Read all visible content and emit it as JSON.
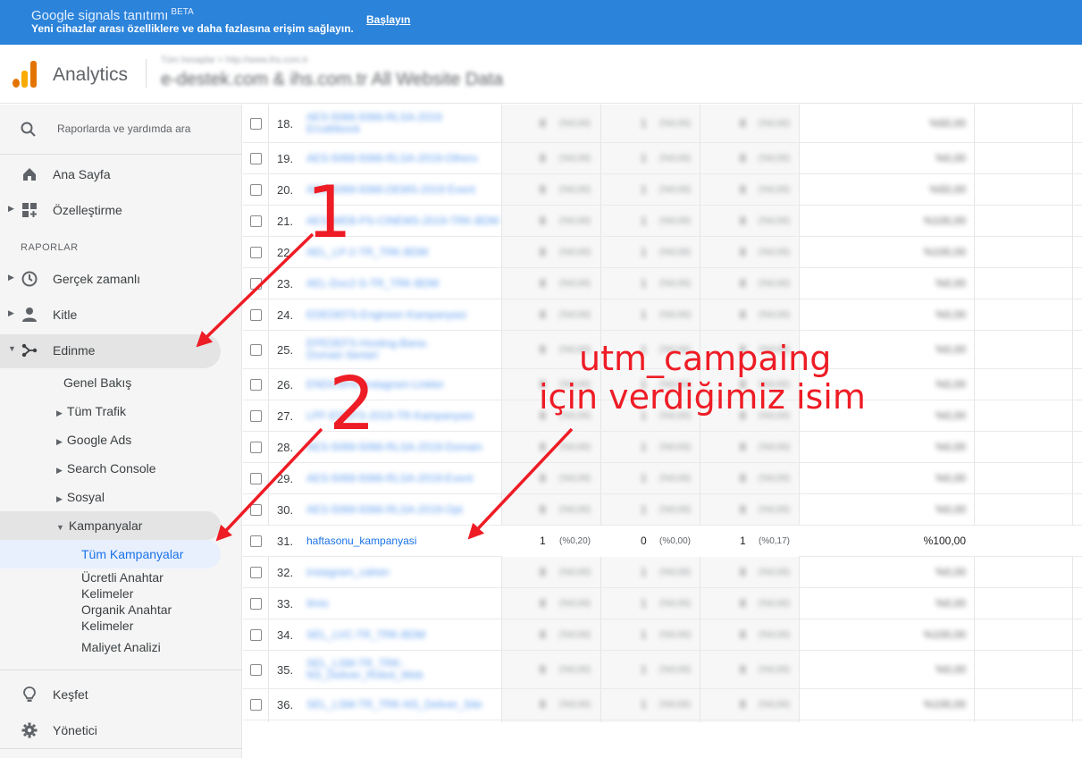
{
  "banner": {
    "title": "Google signals tanıtımı",
    "badge": "BETA",
    "subtitle": "Yeni cihazlar arası özelliklere ve daha fazlasına erişim sağlayın.",
    "cta": "Başlayın"
  },
  "header": {
    "app_name": "Analytics",
    "breadcrumb": "Tüm hesaplar > http://www.ihs.com.tr",
    "property": "e-destek.com & ihs.com.tr All Website Data"
  },
  "sidebar": {
    "search_placeholder": "Raporlarda ve yardımda ara",
    "home": "Ana Sayfa",
    "customize": "Özelleştirme",
    "section": "RAPORLAR",
    "realtime": "Gerçek zamanlı",
    "audience": "Kitle",
    "acquisition": "Edinme",
    "overview": "Genel Bakış",
    "all_traffic": "Tüm Trafik",
    "google_ads": "Google Ads",
    "search_console": "Search Console",
    "social": "Sosyal",
    "campaigns": "Kampanyalar",
    "all_campaigns": "Tüm Kampanyalar",
    "paid_keywords_1": "Ücretli Anahtar",
    "paid_keywords_2": "Kelimeler",
    "organic_keywords_1": "Organik Anahtar",
    "organic_keywords_2": "Kelimeler",
    "cost_analysis": "Maliyet Analizi",
    "discover": "Keşfet",
    "admin": "Yönetici"
  },
  "table": {
    "rows": [
      {
        "n": "18.",
        "name": "AES-5066-5066-RLSA-2019 Ercafébock",
        "v1": "8",
        "p1": "(%0,00)",
        "v2": "1",
        "p2": "(%0,00)",
        "v3": "8",
        "p3": "(%0,00)",
        "r": "%50,00"
      },
      {
        "n": "19.",
        "name": "AES-5069-5066-RLSA-2019-Others",
        "v1": "8",
        "p1": "(%0,00)",
        "v2": "1",
        "p2": "(%0,00)",
        "v3": "8",
        "p3": "(%0,00)",
        "r": "%0,00"
      },
      {
        "n": "20.",
        "name": "AES-5069-5066-DEMS-2019 Event",
        "v1": "8",
        "p1": "(%0,00)",
        "v2": "1",
        "p2": "(%0,00)",
        "v3": "8",
        "p3": "(%0,00)",
        "r": "%50,00"
      },
      {
        "n": "21.",
        "name": "AES-WEB-PS-CINEMS-2019-TRK-BDM",
        "v1": "8",
        "p1": "(%0,00)",
        "v2": "1",
        "p2": "(%0,00)",
        "v3": "8",
        "p3": "(%0,00)",
        "r": "%100,00"
      },
      {
        "n": "22.",
        "name": "AEL_LP-2-TR_TRK-BDM",
        "v1": "8",
        "p1": "(%0,00)",
        "v2": "1",
        "p2": "(%0,00)",
        "v3": "8",
        "p3": "(%0,00)",
        "r": "%100,00"
      },
      {
        "n": "23.",
        "name": "AEL-Doc2-S-TR_TRK-BDM",
        "v1": "8",
        "p1": "(%0,00)",
        "v2": "1",
        "p2": "(%0,00)",
        "v3": "8",
        "p3": "(%0,00)",
        "r": "%0,00"
      },
      {
        "n": "24.",
        "name": "EDEDEFS-Engineer-Kampanyasi",
        "v1": "8",
        "p1": "(%0,00)",
        "v2": "1",
        "p2": "(%0,00)",
        "v3": "8",
        "p3": "(%0,00)",
        "r": "%0,00"
      },
      {
        "n": "25.",
        "name": "EPEDEFS-Hosting-Bana-Domain Ilanlari",
        "v1": "8",
        "p1": "(%0,00)",
        "v2": "1",
        "p2": "(%0,00)",
        "v3": "8",
        "p3": "(%0,00)",
        "r": "%0,00"
      },
      {
        "n": "26.",
        "name": "ENDOSFA-Instagram-Linkler",
        "v1": "8",
        "p1": "(%0,00)",
        "v2": "1",
        "p2": "(%0,00)",
        "v3": "8",
        "p3": "(%0,00)",
        "r": "%0,00"
      },
      {
        "n": "27.",
        "name": "LPF-EDEFS-2019-TR-Kampanyasi",
        "v1": "8",
        "p1": "(%0,00)",
        "v2": "1",
        "p2": "(%0,00)",
        "v3": "8",
        "p3": "(%0,00)",
        "r": "%0,00"
      },
      {
        "n": "28.",
        "name": "AES-5069-5066-RLSA-2019-Domain",
        "v1": "8",
        "p1": "(%0,00)",
        "v2": "1",
        "p2": "(%0,00)",
        "v3": "8",
        "p3": "(%0,00)",
        "r": "%0,00"
      },
      {
        "n": "29.",
        "name": "AES-5069-5066-RLSA-2019-Event",
        "v1": "8",
        "p1": "(%0,00)",
        "v2": "1",
        "p2": "(%0,00)",
        "v3": "8",
        "p3": "(%0,00)",
        "r": "%0,00"
      },
      {
        "n": "30.",
        "name": "AES-5069-5066-RLSA-2019-Opt",
        "v1": "8",
        "p1": "(%0,00)",
        "v2": "1",
        "p2": "(%0,00)",
        "v3": "8",
        "p3": "(%0,00)",
        "r": "%0,00"
      },
      {
        "n": "31.",
        "name": "haftasonu_kampanyasi",
        "v1": "1",
        "p1": "(%0,20)",
        "v2": "0",
        "p2": "(%0,00)",
        "v3": "1",
        "p3": "(%0,17)",
        "r": "%100,00",
        "highlight": true
      },
      {
        "n": "32.",
        "name": "instagram_calisin",
        "v1": "8",
        "p1": "(%0,00)",
        "v2": "1",
        "p2": "(%0,00)",
        "v3": "8",
        "p3": "(%0,00)",
        "r": "%0,00"
      },
      {
        "n": "33.",
        "name": "Ilmis",
        "v1": "8",
        "p1": "(%0,00)",
        "v2": "1",
        "p2": "(%0,00)",
        "v3": "8",
        "p3": "(%0,00)",
        "r": "%0,00"
      },
      {
        "n": "34.",
        "name": "SEL_LVC-TR_TRK-BDM",
        "v1": "8",
        "p1": "(%0,00)",
        "v2": "1",
        "p2": "(%0,00)",
        "v3": "8",
        "p3": "(%0,00)",
        "r": "%100,00"
      },
      {
        "n": "35.",
        "name": "SEL_LSM-TR_TRK-NS_Deliver_Robot_Web",
        "v1": "8",
        "p1": "(%0,00)",
        "v2": "1",
        "p2": "(%0,00)",
        "v3": "8",
        "p3": "(%0,00)",
        "r": "%0,00"
      },
      {
        "n": "36.",
        "name": "SEL_LSM-TR_TRK-NS_Deliver_Site",
        "v1": "8",
        "p1": "(%0,00)",
        "v2": "1",
        "p2": "(%0,00)",
        "v3": "8",
        "p3": "(%0,00)",
        "r": "%100,00"
      }
    ]
  },
  "annotations": {
    "step1": "1",
    "step2": "2",
    "note_line1": "utm_campaing",
    "note_line2": "için verdiğimiz isim",
    "color": "#ee1c25"
  },
  "colors": {
    "banner": "#2b83da",
    "link": "#1a73e8",
    "logo_orange": "#f9ab00",
    "logo_dark_orange": "#e37400"
  }
}
